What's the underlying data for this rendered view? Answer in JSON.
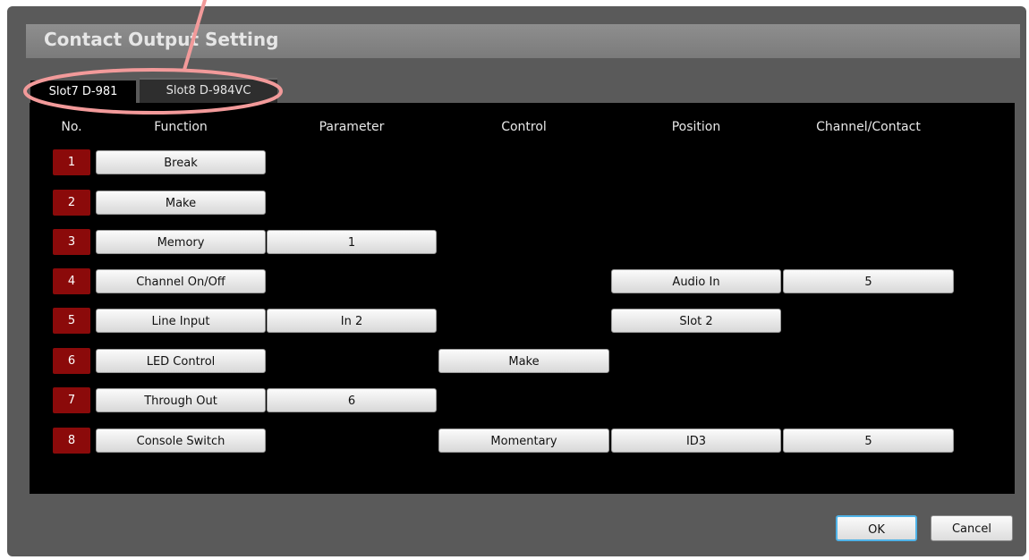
{
  "dialog": {
    "title": "Contact Output Setting"
  },
  "tabs": [
    {
      "label": "Slot7  D-981",
      "active": true
    },
    {
      "label": "Slot8  D-984VC",
      "active": false
    }
  ],
  "columns": {
    "no": "No.",
    "function": "Function",
    "parameter": "Parameter",
    "control": "Control",
    "position": "Position",
    "channel": "Channel/Contact"
  },
  "rows": [
    {
      "no": "1",
      "function": "Break",
      "parameter": "",
      "control": "",
      "position": "",
      "channel": ""
    },
    {
      "no": "2",
      "function": "Make",
      "parameter": "",
      "control": "",
      "position": "",
      "channel": ""
    },
    {
      "no": "3",
      "function": "Memory",
      "parameter": "1",
      "control": "",
      "position": "",
      "channel": ""
    },
    {
      "no": "4",
      "function": "Channel On/Off",
      "parameter": "",
      "control": "",
      "position": "Audio In",
      "channel": "5"
    },
    {
      "no": "5",
      "function": "Line Input",
      "parameter": "In 2",
      "control": "",
      "position": "Slot 2",
      "channel": ""
    },
    {
      "no": "6",
      "function": "LED Control",
      "parameter": "",
      "control": "Make",
      "position": "",
      "channel": ""
    },
    {
      "no": "7",
      "function": "Through Out",
      "parameter": "6",
      "control": "",
      "position": "",
      "channel": ""
    },
    {
      "no": "8",
      "function": "Console Switch",
      "parameter": "",
      "control": "Momentary",
      "position": "ID3",
      "channel": "5"
    }
  ],
  "buttons": {
    "ok": "OK",
    "cancel": "Cancel"
  },
  "colors": {
    "window_bg": "#5a5a5a",
    "number_badge": "#8b0a0a",
    "annotation": "#f29a9a",
    "ok_focus": "#4fb3e8"
  }
}
